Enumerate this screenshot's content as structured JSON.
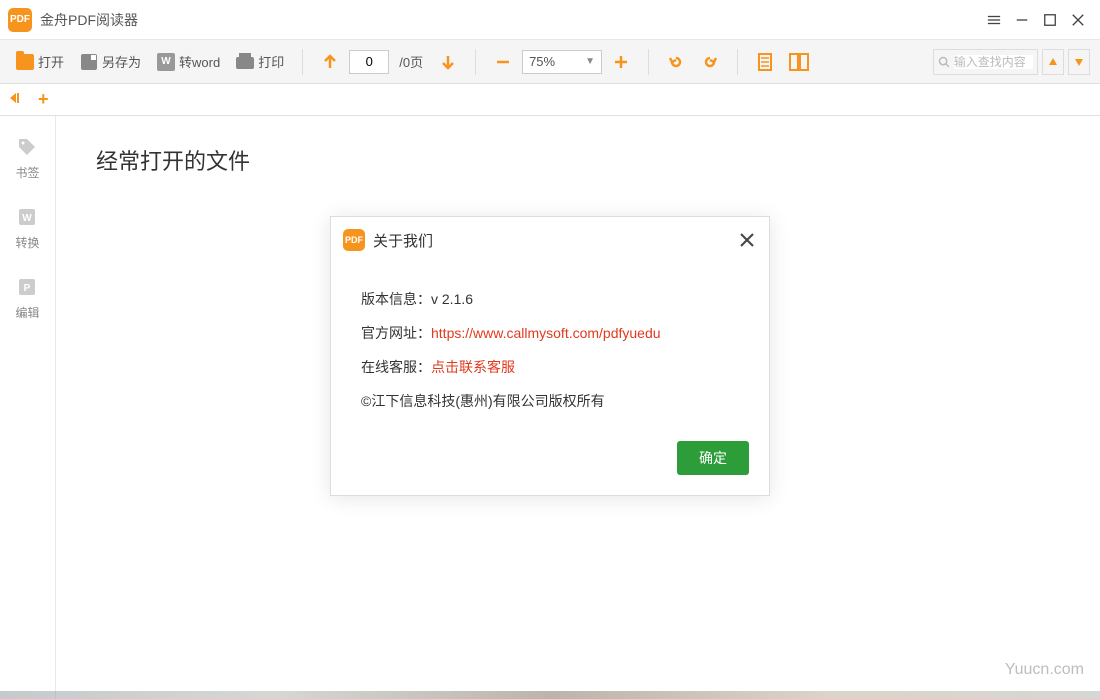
{
  "app": {
    "title": "金舟PDF阅读器",
    "icon_text": "PDF"
  },
  "toolbar": {
    "open": "打开",
    "save_as": "另存为",
    "to_word": "转word",
    "print": "打印",
    "page_current": "0",
    "page_total": "/0页",
    "zoom": "75%"
  },
  "search": {
    "placeholder": "输入查找内容"
  },
  "sidebar": {
    "items": [
      {
        "label": "书签",
        "icon": "tag-icon"
      },
      {
        "label": "转换",
        "icon": "word-convert-icon"
      },
      {
        "label": "编辑",
        "icon": "edit-icon"
      }
    ]
  },
  "main": {
    "heading": "经常打开的文件"
  },
  "dialog": {
    "title": "关于我们",
    "icon_text": "PDF",
    "version_label": "版本信息：",
    "version_value": "v 2.1.6",
    "website_label": "官方网址：",
    "website_value": "https://www.callmysoft.com/pdfyuedu",
    "support_label": "在线客服：",
    "support_value": "点击联系客服",
    "copyright": "©江下信息科技(惠州)有限公司版权所有",
    "ok": "确定"
  },
  "watermark": "Yuucn.com"
}
